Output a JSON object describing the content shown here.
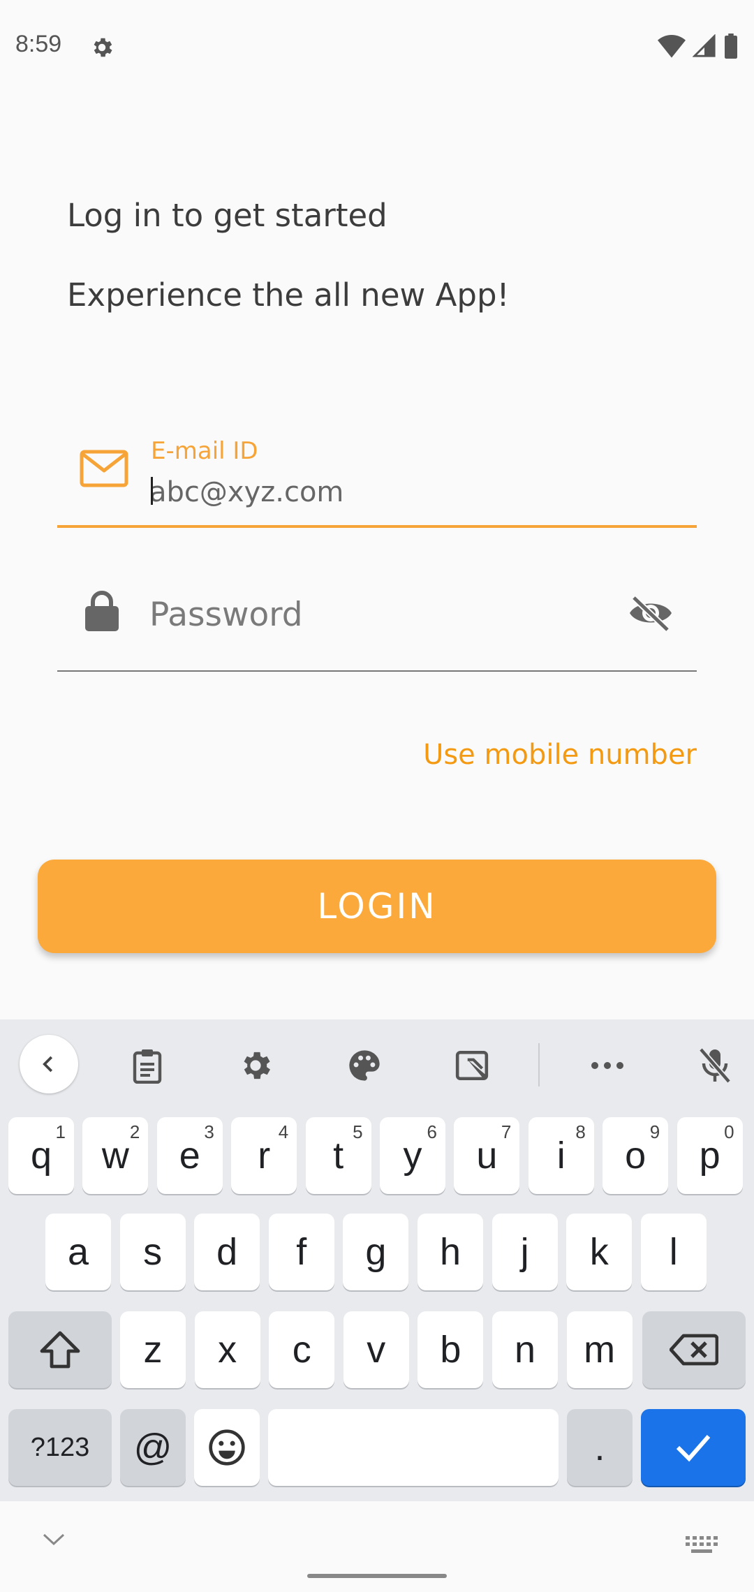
{
  "status_bar": {
    "time": "8:59",
    "icons": [
      "settings-icon",
      "wifi-icon",
      "signal-icon",
      "battery-icon"
    ]
  },
  "header": {
    "title": "Log in to get started",
    "subtitle": "Experience the all new App!"
  },
  "form": {
    "email_label": "E-mail ID",
    "email_placeholder": "abc@xyz.com",
    "email_value": "",
    "password_placeholder": "Password",
    "password_value": "",
    "use_mobile_label": "Use mobile number",
    "login_label": "LOGIN"
  },
  "colors": {
    "accent": "#f6a438",
    "button": "#fba93b",
    "keyboard_bg": "#e8eaed",
    "enter_key": "#1a73e8"
  },
  "keyboard": {
    "toolbar_icons": [
      "back-icon",
      "clipboard-icon",
      "settings-icon",
      "palette-icon",
      "edit-icon",
      "more-icon",
      "mic-off-icon"
    ],
    "row1": [
      {
        "k": "q",
        "s": "1"
      },
      {
        "k": "w",
        "s": "2"
      },
      {
        "k": "e",
        "s": "3"
      },
      {
        "k": "r",
        "s": "4"
      },
      {
        "k": "t",
        "s": "5"
      },
      {
        "k": "y",
        "s": "6"
      },
      {
        "k": "u",
        "s": "7"
      },
      {
        "k": "i",
        "s": "8"
      },
      {
        "k": "o",
        "s": "9"
      },
      {
        "k": "p",
        "s": "0"
      }
    ],
    "row2": [
      "a",
      "s",
      "d",
      "f",
      "g",
      "h",
      "j",
      "k",
      "l"
    ],
    "row3": [
      "z",
      "x",
      "c",
      "v",
      "b",
      "n",
      "m"
    ],
    "row4": {
      "sym": "?123",
      "at": "@",
      "period": "."
    }
  }
}
